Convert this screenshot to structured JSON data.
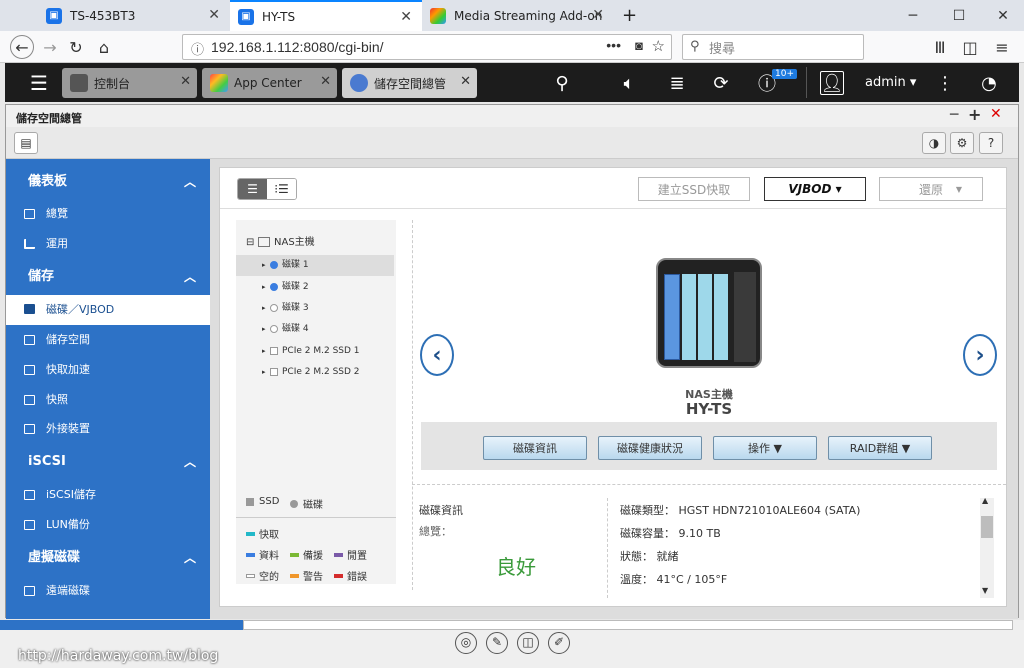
{
  "browser": {
    "tabs": [
      {
        "title": "TS-453BT3"
      },
      {
        "title": "HY-TS"
      },
      {
        "title": "Media Streaming Add-on"
      }
    ],
    "url": "192.168.1.112:8080/cgi-bin/",
    "search_placeholder": "搜尋"
  },
  "qts": {
    "apps": [
      {
        "label": "控制台"
      },
      {
        "label": "App Center"
      },
      {
        "label": "儲存空間總管"
      }
    ],
    "notification_badge": "10+",
    "user": "admin ▾"
  },
  "window": {
    "title": "儲存空間總管"
  },
  "sidebar": {
    "sections": [
      {
        "label": "儀表板",
        "items": [
          {
            "label": "總覽"
          },
          {
            "label": "運用"
          }
        ]
      },
      {
        "label": "儲存",
        "items": [
          {
            "label": "磁碟／VJBOD"
          },
          {
            "label": "儲存空間"
          },
          {
            "label": "快取加速"
          },
          {
            "label": "快照"
          },
          {
            "label": "外接裝置"
          }
        ]
      },
      {
        "label": "iSCSI",
        "items": [
          {
            "label": "iSCSI儲存"
          },
          {
            "label": "LUN備份"
          }
        ]
      },
      {
        "label": "虛擬磁碟",
        "items": [
          {
            "label": "遠端磁碟"
          }
        ]
      }
    ]
  },
  "toolbar": {
    "create_ssd_cache": "建立SSD快取",
    "vjbod": "VJBOD ▾",
    "restore": "還原"
  },
  "tree": {
    "root": "NAS主機",
    "nodes": [
      {
        "label": "磁碟 1"
      },
      {
        "label": "磁碟 2"
      },
      {
        "label": "磁碟 3"
      },
      {
        "label": "磁碟 4"
      },
      {
        "label": "PCIe 2 M.2 SSD 1"
      },
      {
        "label": "PCIe 2 M.2 SSD 2"
      }
    ]
  },
  "legend": {
    "ssd": "SSD",
    "disk": "磁碟",
    "cache": "快取",
    "data": "資料",
    "spare": "備援",
    "idle": "閒置",
    "free": "空的",
    "warning": "警告",
    "error": "錯誤"
  },
  "device": {
    "caption": "NAS主機",
    "name": "HY-TS"
  },
  "actions": {
    "disk_info": "磁碟資訊",
    "disk_health": "磁碟健康狀況",
    "operate": "操作 ▼",
    "raid_group": "RAID群組 ▼"
  },
  "info": {
    "heading": "磁碟資訊",
    "overview_label": "總覽：",
    "overview_value": "良好",
    "disk_type": "磁碟類型： HGST HDN721010ALE604 (SATA)",
    "capacity": "磁碟容量： 9.10 TB",
    "status": "狀態： 就緒",
    "temperature": "溫度： 41°C / 105°F"
  },
  "watermark": "http://hardaway.com.tw/blog",
  "colors": {
    "sidebar": "#2d72c6",
    "cache": "#22b8c8",
    "data": "#3a7de0",
    "spare": "#7ab833",
    "idle": "#7a5aa8",
    "warning": "#f0962a",
    "error": "#d42c2c",
    "good": "#3a9a3a"
  }
}
